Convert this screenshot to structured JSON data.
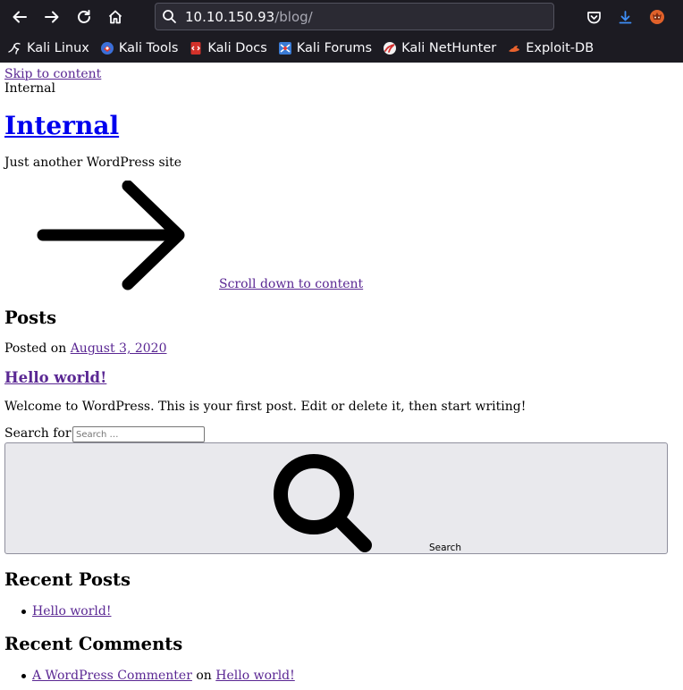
{
  "browser": {
    "url_host": "10.10.150.93",
    "url_path": "/blog/",
    "bookmarks": [
      {
        "label": "Kali Linux",
        "icon": "kali-dragon-icon"
      },
      {
        "label": "Kali Tools",
        "icon": "kali-tools-icon"
      },
      {
        "label": "Kali Docs",
        "icon": "kali-docs-icon"
      },
      {
        "label": "Kali Forums",
        "icon": "kali-forums-icon"
      },
      {
        "label": "Kali NetHunter",
        "icon": "kali-nethunter-icon"
      },
      {
        "label": "Exploit-DB",
        "icon": "exploit-db-icon"
      }
    ],
    "colors": {
      "toolbar": "#1c1b22",
      "urlbar": "#2b2a33",
      "download_accent": "#3e8ef7"
    }
  },
  "page": {
    "skip_link": "Skip to content",
    "header_text": "Internal",
    "site_title": "Internal",
    "tagline": "Just another WordPress site",
    "scroll_link": "Scroll down to content",
    "posts_heading": "Posts",
    "posted_on_label": "Posted on",
    "post_date": "August 3, 2020",
    "post_title": "Hello world!",
    "post_excerpt": "Welcome to WordPress. This is your first post. Edit or delete it, then start writing!",
    "search_label": "Search for:",
    "search_placeholder": "Search …",
    "search_button": "Search",
    "recent_posts_heading": "Recent Posts",
    "recent_posts": [
      "Hello world!"
    ],
    "recent_comments_heading": "Recent Comments",
    "recent_comment": {
      "author": "A WordPress Commenter",
      "on": "on",
      "post": "Hello world!"
    },
    "colors": {
      "link": "#5a2793",
      "title_link": "#0000ee"
    }
  }
}
